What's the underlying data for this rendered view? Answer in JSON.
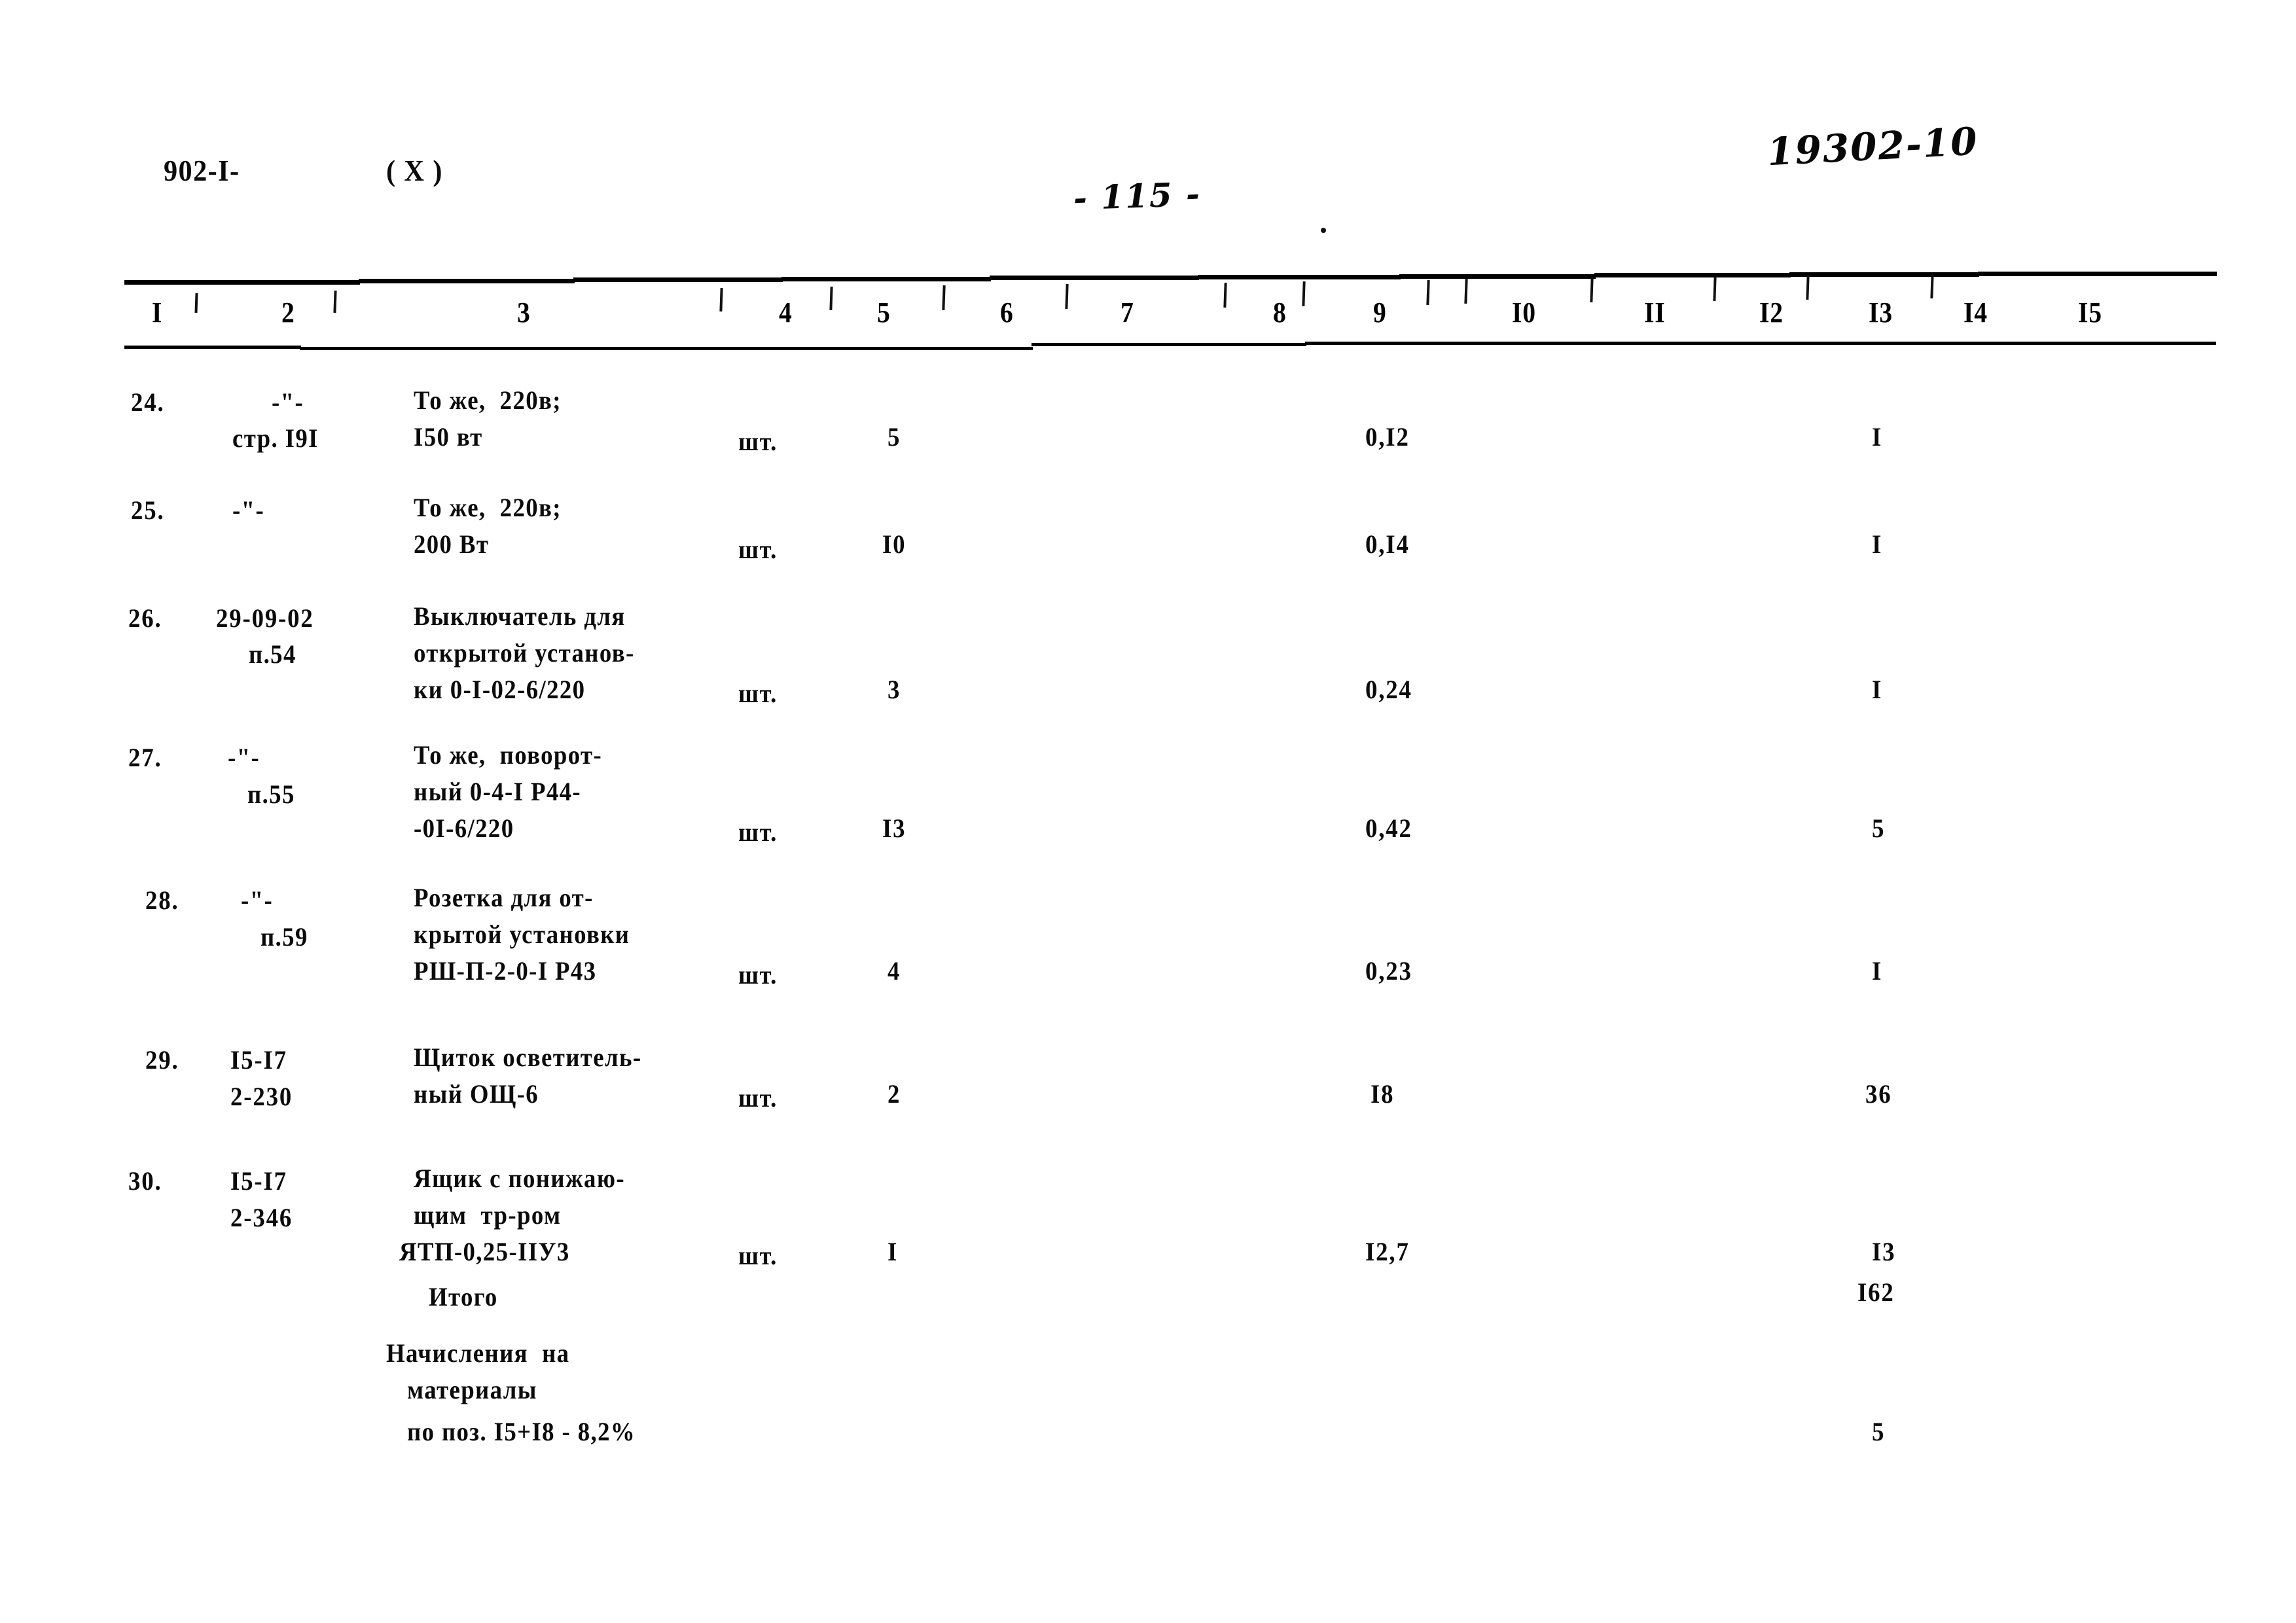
{
  "page": {
    "series_code": "902-I-",
    "revision_mark": "( X )",
    "page_number": "- 115 -",
    "archive_code": "19302-10"
  },
  "table": {
    "column_headers": [
      "I",
      "2",
      "3",
      "4",
      "5",
      "6",
      "7",
      "8",
      "9",
      "I0",
      "II",
      "I2",
      "I3",
      "I4",
      "I5"
    ],
    "rows": [
      {
        "num": "24.",
        "code_lines": [
          "-\"-",
          "стр. I9I"
        ],
        "name_lines": [
          "То же,  220в;",
          "I50 вт"
        ],
        "unit": "шт.",
        "qty": "5",
        "col9": "0,I2",
        "col13": "I"
      },
      {
        "num": "25.",
        "code_lines": [
          "-\"-",
          ""
        ],
        "name_lines": [
          "То же,  220в;",
          "200 Вт"
        ],
        "unit": "шт.",
        "qty": "I0",
        "col9": "0,I4",
        "col13": "I"
      },
      {
        "num": "26.",
        "code_lines": [
          "29-09-02",
          "п.54"
        ],
        "name_lines": [
          "Выключатель для",
          "открытой установ-",
          "ки 0-I-02-6/220"
        ],
        "unit": "шт.",
        "qty": "3",
        "col9": "0,24",
        "col13": "I"
      },
      {
        "num": "27.",
        "code_lines": [
          "-\"-",
          "п.55"
        ],
        "name_lines": [
          "То же,  поворот-",
          "ный 0-4-I Р44-",
          "-0I-6/220"
        ],
        "unit": "шт.",
        "qty": "I3",
        "col9": "0,42",
        "col13": "5"
      },
      {
        "num": "28.",
        "code_lines": [
          "-\"-",
          "п.59"
        ],
        "name_lines": [
          "Розетка для от-",
          "крытой установки",
          "РШ-П-2-0-I Р43"
        ],
        "unit": "шт.",
        "qty": "4",
        "col9": "0,23",
        "col13": "I"
      },
      {
        "num": "29.",
        "code_lines": [
          "I5-I7",
          "2-230"
        ],
        "name_lines": [
          "Щиток осветитель-",
          "ный ОЩ-6"
        ],
        "unit": "шт.",
        "qty": "2",
        "col9": "I8",
        "col13": "36"
      },
      {
        "num": "30.",
        "code_lines": [
          "I5-I7",
          "2-346"
        ],
        "name_lines": [
          "Ящик с понижаю-",
          "щим  тр-ром",
          "ЯТП-0,25-IIУ3"
        ],
        "unit": "шт.",
        "qty": "I",
        "col9": "I2,7",
        "col13": "I3"
      }
    ],
    "summary": [
      {
        "label_lines": [
          "Итого"
        ],
        "col13": "I62"
      },
      {
        "label_lines": [
          "Начисления  на",
          "материалы",
          "по поз. I5+I8 - 8,2%"
        ],
        "col13": "5"
      }
    ]
  }
}
